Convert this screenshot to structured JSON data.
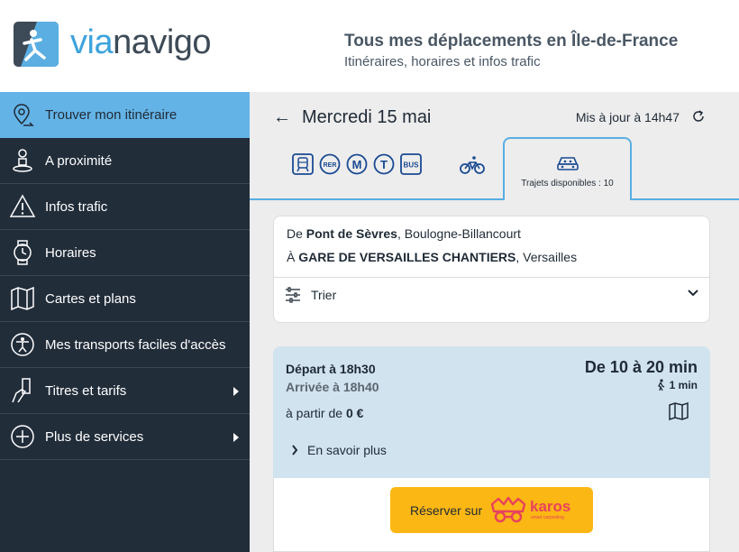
{
  "header": {
    "logo_via": "via",
    "logo_navigo": "navigo",
    "tagline_title": "Tous mes déplacements en Île-de-France",
    "tagline_sub": "Itinéraires, horaires et infos trafic"
  },
  "sidebar": {
    "items": [
      {
        "label": "Trouver mon itinéraire",
        "icon": "location-pin-icon",
        "active": true
      },
      {
        "label": "A proximité",
        "icon": "person-pin-icon"
      },
      {
        "label": "Infos trafic",
        "icon": "warning-icon"
      },
      {
        "label": "Horaires",
        "icon": "watch-icon"
      },
      {
        "label": "Cartes et plans",
        "icon": "map-icon"
      },
      {
        "label": "Mes transports faciles d'accès",
        "icon": "accessibility-icon"
      },
      {
        "label": "Titres et tarifs",
        "icon": "ticket-hand-icon",
        "has_submenu": true
      },
      {
        "label": "Plus de services",
        "icon": "plus-circle-icon",
        "has_submenu": true
      }
    ]
  },
  "main": {
    "date": "Mercredi 15 mai",
    "updated": "Mis à jour à 14h47",
    "modes": {
      "rer": "RER",
      "metro": "M",
      "tram": "T",
      "bus": "BUS",
      "carpool_tab_label": "Trajets disponibles : 10"
    },
    "od": {
      "from_prefix": "De",
      "from_place": "Pont de Sèvres",
      "from_city": ", Boulogne-Billancourt",
      "to_prefix": "À",
      "to_place": "GARE DE VERSAILLES CHANTIERS",
      "to_city": ", Versailles",
      "sort_label": "Trier"
    },
    "trip": {
      "departure": "Départ à 18h30",
      "arrival": "Arrivée à 18h40",
      "duration": "De 10 à 20 min",
      "walk": "1 min",
      "price_prefix": "à partir de",
      "price_value": "0 €",
      "more_label": "En savoir plus",
      "book_label": "Réserver sur",
      "partner_name": "karos",
      "partner_tagline": "smart carpooling"
    }
  },
  "colors": {
    "sidebar_bg": "#222d3a",
    "sidebar_active": "#64b3e6",
    "accent_blue": "#3ea3dd",
    "trip_bg": "#d1e3ef",
    "book_button": "#fbb714",
    "karos": "#e8425c"
  }
}
